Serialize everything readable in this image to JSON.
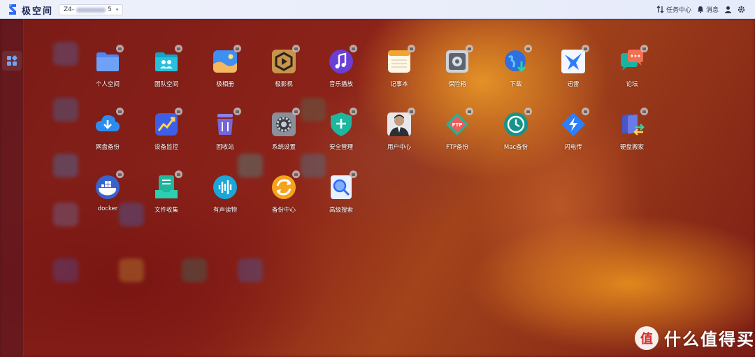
{
  "app": {
    "title": "极空间"
  },
  "device": {
    "name_prefix": "Z4-",
    "name_suffix": "5"
  },
  "topbar": {
    "tasks_label": "任务中心",
    "messages_label": "消息"
  },
  "apps": [
    {
      "label": "个人空间",
      "icon": "folder-icon"
    },
    {
      "label": "团队空间",
      "icon": "team-folder-icon"
    },
    {
      "label": "极相册",
      "icon": "photo-album-icon"
    },
    {
      "label": "极影视",
      "icon": "video-icon"
    },
    {
      "label": "音乐播放",
      "icon": "music-icon"
    },
    {
      "label": "记事本",
      "icon": "notepad-icon"
    },
    {
      "label": "保险箱",
      "icon": "safe-icon"
    },
    {
      "label": "下载",
      "icon": "download-icon"
    },
    {
      "label": "迅雷",
      "icon": "thunder-icon"
    },
    {
      "label": "论坛",
      "icon": "forum-icon"
    },
    {
      "label": "网盘备份",
      "icon": "cloud-backup-icon"
    },
    {
      "label": "设备监控",
      "icon": "monitor-icon"
    },
    {
      "label": "回收站",
      "icon": "trash-icon"
    },
    {
      "label": "系统设置",
      "icon": "settings-icon"
    },
    {
      "label": "安全管理",
      "icon": "shield-icon"
    },
    {
      "label": "用户中心",
      "icon": "user-center-icon"
    },
    {
      "label": "FTP备份",
      "icon": "ftp-icon"
    },
    {
      "label": "Mac备份",
      "icon": "time-machine-icon"
    },
    {
      "label": "闪电传",
      "icon": "flash-transfer-icon"
    },
    {
      "label": "硬盘搬家",
      "icon": "disk-move-icon"
    },
    {
      "label": "docker",
      "icon": "docker-icon"
    },
    {
      "label": "文件收集",
      "icon": "file-collect-icon"
    },
    {
      "label": "有声读物",
      "icon": "audiobook-icon"
    },
    {
      "label": "备份中心",
      "icon": "backup-center-icon"
    },
    {
      "label": "高级搜索",
      "icon": "advanced-search-icon"
    }
  ],
  "watermark": {
    "text": "什么值得买",
    "glyph": "值"
  },
  "colors": {
    "topbar_bg": "#eef1fb",
    "accent": "#2f6bf2"
  }
}
